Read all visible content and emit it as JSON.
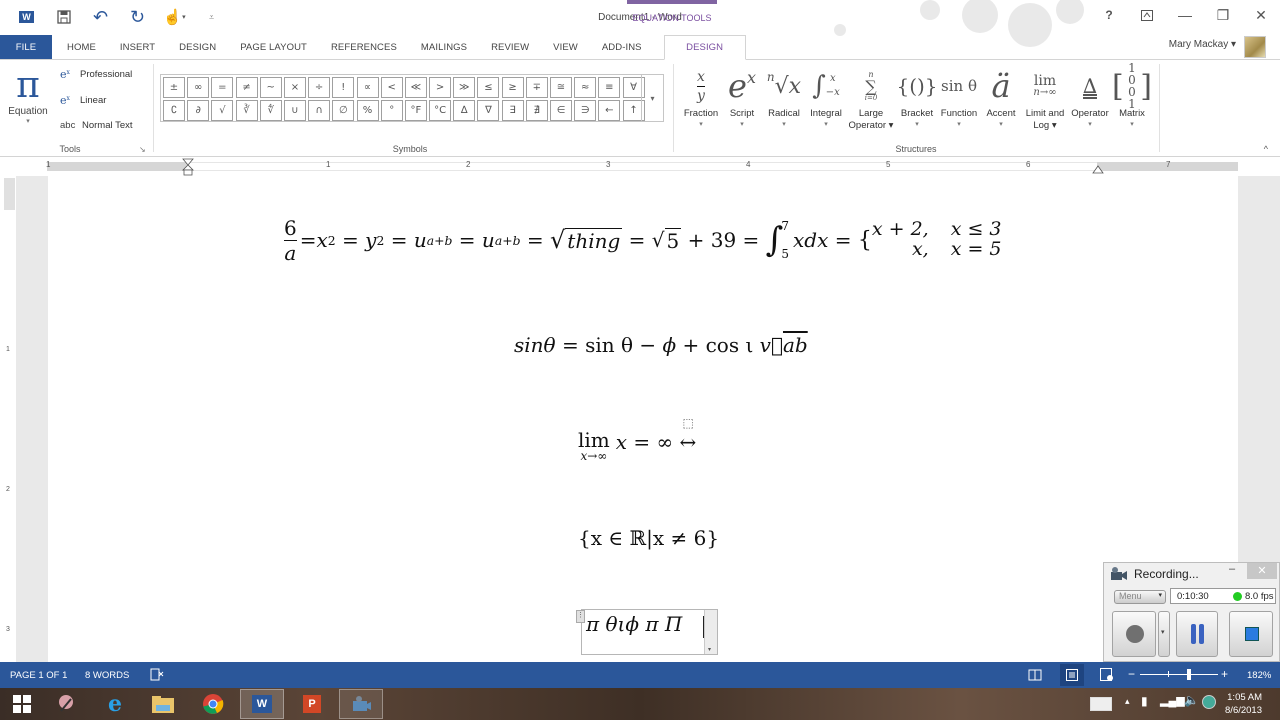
{
  "window": {
    "title": "Document1 - Word",
    "context_tab_group": "EQUATION TOOLS",
    "help": "?",
    "ribbon_display": "⊼",
    "minimize": "—",
    "restore": "❐",
    "close": "✕"
  },
  "qat": {
    "app_icon": "W",
    "save": "💾",
    "undo": "↶",
    "redo": "↻",
    "touch_mode": "☝",
    "customize": "⩡"
  },
  "tabs": [
    {
      "label": "FILE"
    },
    {
      "label": "HOME"
    },
    {
      "label": "INSERT"
    },
    {
      "label": "DESIGN"
    },
    {
      "label": "PAGE LAYOUT"
    },
    {
      "label": "REFERENCES"
    },
    {
      "label": "MAILINGS"
    },
    {
      "label": "REVIEW"
    },
    {
      "label": "VIEW"
    },
    {
      "label": "ADD-INS"
    },
    {
      "label": "DESIGN",
      "active": true
    }
  ],
  "user": {
    "name": "Mary Mackay ▾"
  },
  "ribbon": {
    "tools": {
      "equation_glyph": "π",
      "equation_label": "Equation",
      "equation_arrow": "▾",
      "professional": "Professional",
      "linear": "Linear",
      "normal_text_icon": "abc",
      "normal_text": "Normal Text",
      "group_label": "Tools",
      "launcher": "↘"
    },
    "symbols": {
      "items": [
        "±",
        "∞",
        "=",
        "≠",
        "~",
        "×",
        "÷",
        "!",
        "∝",
        "<",
        "≪",
        ">",
        "≫",
        "≤",
        "≥",
        "∓",
        "≅",
        "≈",
        "≡",
        "∀",
        "∁",
        "∂",
        "√",
        "∛",
        "∜",
        "∪",
        "∩",
        "∅",
        "%",
        "°",
        "°F",
        "°C",
        "∆",
        "∇",
        "∃",
        "∄",
        "∈",
        "∋",
        "←",
        "↑"
      ],
      "more": "▾",
      "group_label": "Symbols"
    },
    "structures": {
      "items": [
        {
          "label": "Fraction",
          "arrow": "▾"
        },
        {
          "glyph": "eˣ",
          "label": "Script",
          "arrow": "▾"
        },
        {
          "glyph": "ⁿ√x",
          "label": "Radical",
          "arrow": "▾"
        },
        {
          "glyph": "∫",
          "label": "Integral",
          "arrow": "▾"
        },
        {
          "glyph": "∑",
          "label": "Large",
          "label2": "Operator ▾"
        },
        {
          "glyph": "{()}",
          "label": "Bracket",
          "arrow": "▾"
        },
        {
          "glyph": "sinθ",
          "label": "Function",
          "arrow": "▾"
        },
        {
          "glyph": "ä",
          "label": "Accent",
          "arrow": "▾"
        },
        {
          "glyph": "lim",
          "label": "Limit and",
          "label2": "Log ▾"
        },
        {
          "glyph": "∆",
          "label": "Operator",
          "arrow": "▾"
        },
        {
          "glyph": "[1 0 / 0 1]",
          "label": "Matrix",
          "arrow": "▾"
        }
      ],
      "group_label": "Structures",
      "collapse": "^"
    }
  },
  "ruler": {
    "numbers": [
      "1",
      "1",
      "2",
      "3",
      "4",
      "5",
      "6",
      "7"
    ],
    "vnumbers": [
      "1",
      "2",
      "3"
    ],
    "tab_selector": "L"
  },
  "document": {
    "eq1": {
      "frac_num": "6",
      "frac_den": "a",
      "t1": "= ",
      "x": "x",
      "sq": "2",
      "t2": " = ",
      "y": "y",
      "t3": " = ",
      "u": "u",
      "ab": "a+b",
      "t4": " = ",
      "thing": "thing",
      "t5": " = √",
      "five": "5",
      "t6": " + 39 = ",
      "int_up": "7",
      "int_lo": "5",
      "xdx": "xdx",
      "t7": " = ",
      "brace": "{",
      "c11": "x + 2,",
      "c12": "x ≤ 3",
      "c21": "x,",
      "c22": "x = 5"
    },
    "eq2": {
      "a": "sinθ",
      "b": " = sin θ − ",
      "phi": "ϕ",
      "c": " + cos ι ",
      "v": "v⃗",
      "ab": "ab"
    },
    "eq3": {
      "lim": "lim",
      "sub": "x→∞",
      "rest": "x",
      "eq": " = ∞ ",
      "arrow": "↔",
      "placeholder": "⬚"
    },
    "eq4": {
      "text": "{x ∈ ℝ|x ≠ 6}"
    },
    "eq5": {
      "text": "π  θιϕ   π  Π",
      "handle": "⋮",
      "scroll_arrow": "▾"
    }
  },
  "status": {
    "page": "PAGE 1 OF 1",
    "words": "8 WORDS",
    "proofing_icon": "📖",
    "zoom_minus": "−",
    "zoom_plus": "+",
    "zoom": "182%",
    "zoom_fraction": 0.6
  },
  "taskbar": {
    "time": "1:05 AM",
    "date": "8/6/2013"
  },
  "recorder": {
    "title": "Recording...",
    "menu": "Menu",
    "time": "0:10:30",
    "fps": "8.0 fps",
    "minimize": "–",
    "restore": "□",
    "close": "✕",
    "status_color": "#22cc22"
  },
  "colors": {
    "word_blue": "#2b579a",
    "eq_purple": "#7a4ea0"
  }
}
